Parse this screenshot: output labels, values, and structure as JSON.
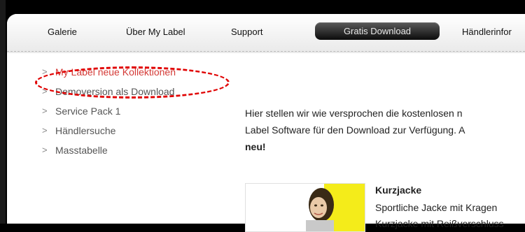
{
  "nav": {
    "items": [
      "Galerie",
      "Über My Label",
      "Support",
      "Gratis Download",
      "Händlerinfor"
    ],
    "active_index": 3
  },
  "sidebar": {
    "items": [
      {
        "label": "My Label neue Kollektionen",
        "active": true
      },
      {
        "label": "Demoversion als Download"
      },
      {
        "label": "Service Pack 1"
      },
      {
        "label": "Händlersuche"
      },
      {
        "label": "Masstabelle"
      }
    ]
  },
  "main": {
    "intro_lines": [
      "Hier stellen wir wie versprochen die kostenlosen n",
      "Label Software für den Download zur Verfügung. A",
      "neu!"
    ],
    "product": {
      "title": "Kurzjacke",
      "description": "Sportliche Jacke mit Kragen",
      "description_line2": "Kurzjacke mit Reißverschluss"
    }
  },
  "colors": {
    "active_link": "#d43a36",
    "highlight": "#e00000",
    "nav_active_bg": "#111111"
  },
  "icons": {
    "sidebar_bullet": "chevron-right-icon"
  }
}
